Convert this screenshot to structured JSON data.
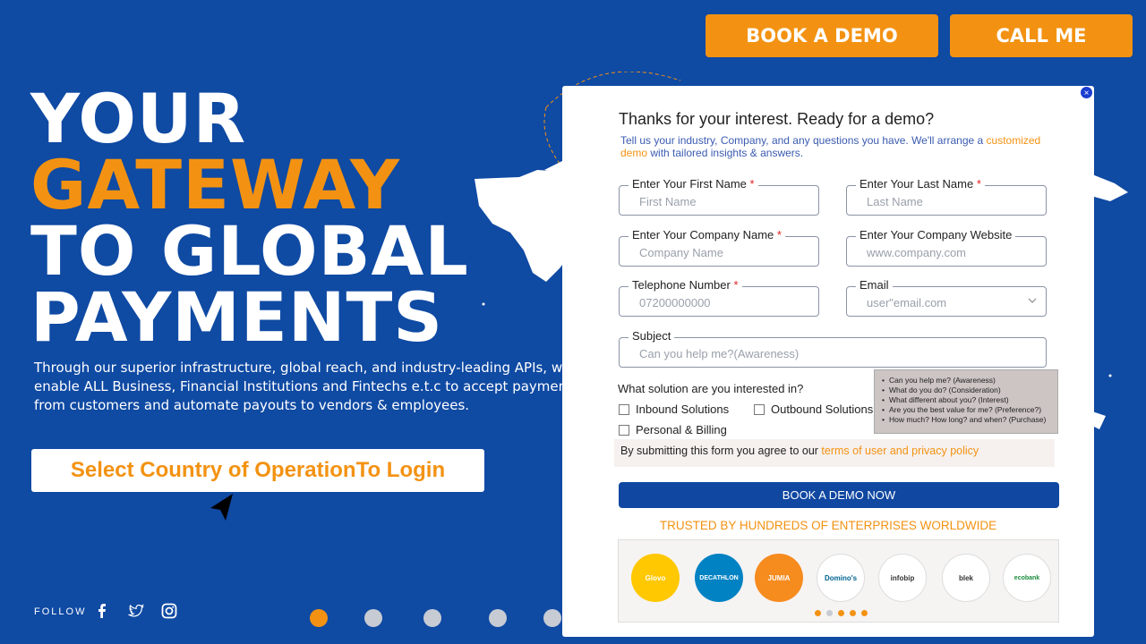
{
  "header": {
    "book_demo": "BOOK A DEMO",
    "call_me": "CALL ME"
  },
  "hero": {
    "line1": "YOUR",
    "line2": "GATEWAY",
    "line3": "TO GLOBAL",
    "line4": "PAYMENTS",
    "description": "Through our superior infrastructure, global reach, and industry-leading APIs, w\nenable ALL Business, Financial Institutions and Fintechs e.t.c  to accept paymen\nfrom customers and automate payouts to vendors & employees.",
    "select_button": "Select Country of OperationTo Login"
  },
  "footer": {
    "follow": "FOLLOW",
    "social_icons": [
      "facebook-icon",
      "twitter-icon",
      "instagram-icon"
    ]
  },
  "carousel": {
    "dots": 5,
    "active": 0
  },
  "modal": {
    "close": "×",
    "title": "Thanks for your interest. Ready for a demo?",
    "subtitle_pre": "Tell us your industry, Company, and any questions you have. We'll arrange a ",
    "subtitle_hl": "customized demo",
    "subtitle_post": " with tailored insights & answers.",
    "fields": {
      "first_name": {
        "label": "Enter Your First Name",
        "required": "*",
        "placeholder": "First Name"
      },
      "last_name": {
        "label": "Enter Your Last Name",
        "required": "*",
        "placeholder": "Last Name"
      },
      "company_name": {
        "label": "Enter Your Company Name",
        "required": "*",
        "placeholder": "Company Name"
      },
      "company_website": {
        "label": "Enter Your Company Website",
        "placeholder": "www.company.com"
      },
      "telephone": {
        "label": "Telephone Number",
        "required": "*",
        "placeholder": "07200000000"
      },
      "email": {
        "label": "Email",
        "placeholder": "user\"email.com"
      },
      "subject": {
        "label": "Subject",
        "placeholder": "Can you help me?(Awareness)"
      }
    },
    "question": "What solution are you interested in?",
    "options": [
      "Inbound Solutions",
      "Outbound Solutions",
      "Personal & Billing"
    ],
    "tooltip": [
      "Can you help me? (Awareness)",
      "What do you do? (Consideration)",
      "What different about you? (Interest)",
      "Are you the best value for me? (Preference?)",
      "How much? How long? and when? (Purchase)"
    ],
    "terms_pre": "By submitting this form you agree to our ",
    "terms_link": "terms of user and privacy policy",
    "submit": "BOOK A DEMO NOW",
    "trusted": "TRUSTED BY HUNDREDS OF ENTERPRISES WORLDWIDE",
    "logos": [
      {
        "name": "Glovo",
        "bg": "#ffc800",
        "fg": "#ffffff"
      },
      {
        "name": "DECATHLON",
        "bg": "#0082c3",
        "fg": "#ffffff"
      },
      {
        "name": "JUMIA",
        "bg": "#f68b1e",
        "fg": "#ffffff"
      },
      {
        "name": "Domino's",
        "bg": "#ffffff",
        "fg": "#006491"
      },
      {
        "name": "infobip",
        "bg": "#ffffff",
        "fg": "#333333"
      },
      {
        "name": "blek",
        "bg": "#ffffff",
        "fg": "#333333"
      },
      {
        "name": "ecobank",
        "bg": "#ffffff",
        "fg": "#1a8a3a"
      }
    ],
    "logo_dots": 5
  },
  "colors": {
    "background": "#0f4aa3",
    "accent": "#f39212",
    "button_blue": "#0f47a1"
  }
}
